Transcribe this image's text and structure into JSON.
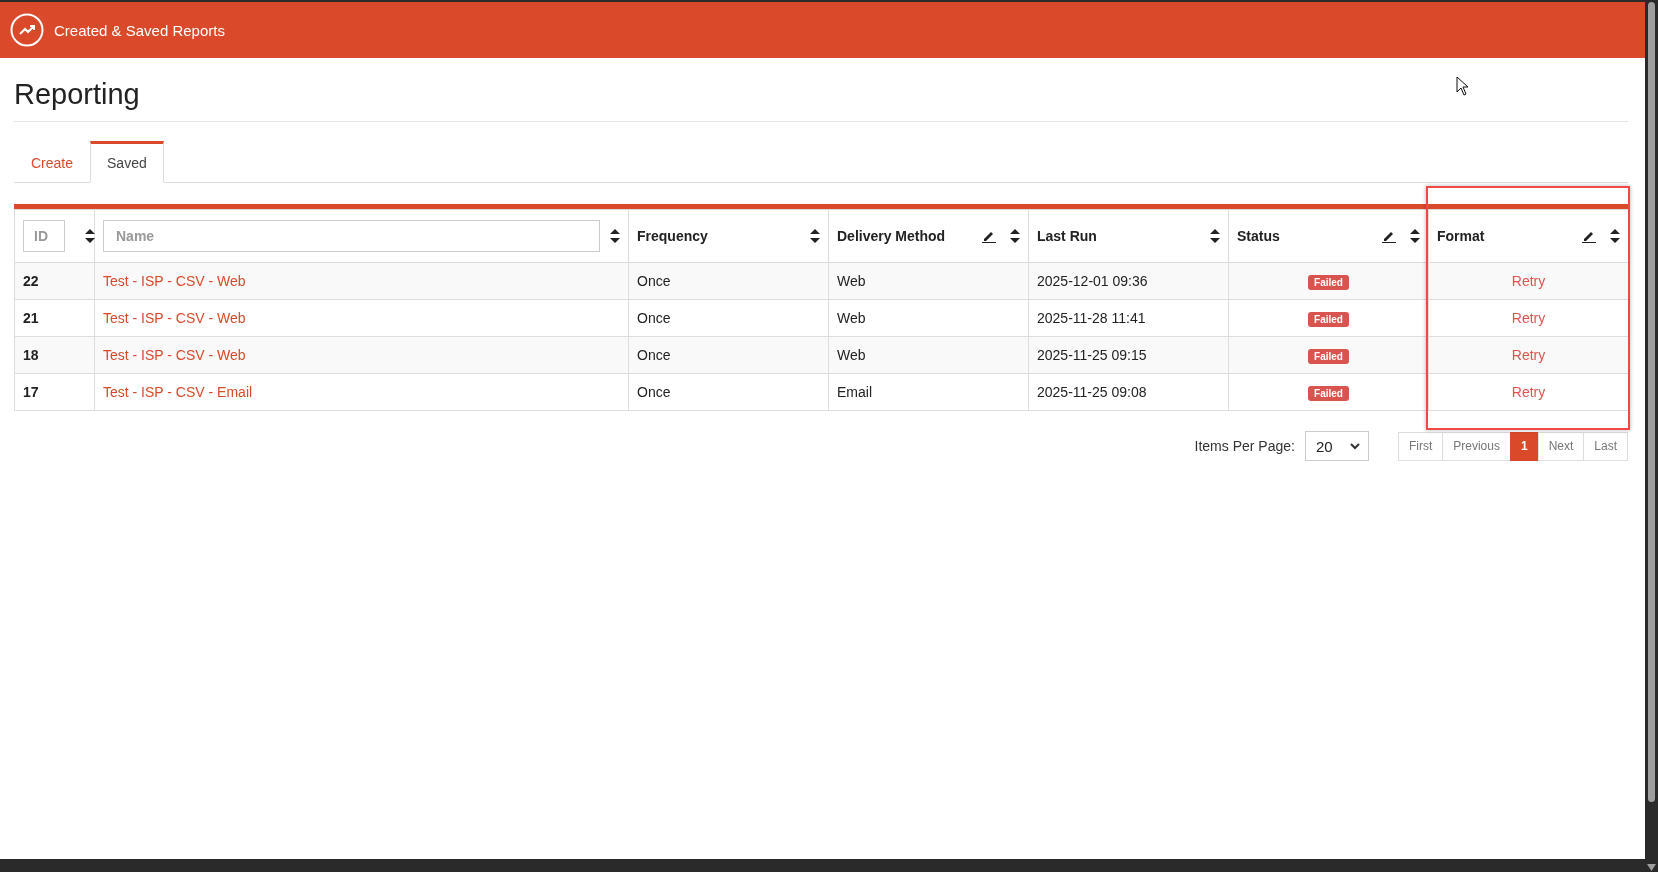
{
  "header": {
    "title": "Created & Saved Reports"
  },
  "page": {
    "title": "Reporting"
  },
  "tabs": [
    {
      "label": "Create",
      "selected": false
    },
    {
      "label": "Saved",
      "selected": true
    }
  ],
  "table": {
    "columns": [
      {
        "kind": "filter",
        "label": "ID",
        "editable": false,
        "highlighted": false
      },
      {
        "kind": "filter",
        "label": "Name",
        "editable": false,
        "highlighted": false
      },
      {
        "kind": "label",
        "label": "Frequency",
        "editable": false,
        "highlighted": false
      },
      {
        "kind": "label",
        "label": "Delivery Method",
        "editable": true,
        "highlighted": false
      },
      {
        "kind": "label",
        "label": "Last Run",
        "editable": false,
        "highlighted": false
      },
      {
        "kind": "label",
        "label": "Status",
        "editable": true,
        "highlighted": false
      },
      {
        "kind": "label",
        "label": "Format",
        "editable": true,
        "highlighted": true
      }
    ],
    "rows": [
      {
        "id": "22",
        "name": "Test - ISP - CSV - Web",
        "frequency": "Once",
        "delivery": "Web",
        "last_run": "2025-12-01 09:36",
        "status": "Failed",
        "format": "Retry"
      },
      {
        "id": "21",
        "name": "Test - ISP - CSV - Web",
        "frequency": "Once",
        "delivery": "Web",
        "last_run": "2025-11-28 11:41",
        "status": "Failed",
        "format": "Retry"
      },
      {
        "id": "18",
        "name": "Test - ISP - CSV - Web",
        "frequency": "Once",
        "delivery": "Web",
        "last_run": "2025-11-25 09:15",
        "status": "Failed",
        "format": "Retry"
      },
      {
        "id": "17",
        "name": "Test - ISP - CSV - Email",
        "frequency": "Once",
        "delivery": "Email",
        "last_run": "2025-11-25 09:08",
        "status": "Failed",
        "format": "Retry"
      }
    ]
  },
  "pagination": {
    "items_label": "Items Per Page:",
    "per_page": "20",
    "pages": [
      {
        "label": "First",
        "selected": false
      },
      {
        "label": "Previous",
        "selected": false
      },
      {
        "label": "1",
        "selected": true
      },
      {
        "label": "Next",
        "selected": false
      },
      {
        "label": "Last",
        "selected": false
      }
    ]
  }
}
